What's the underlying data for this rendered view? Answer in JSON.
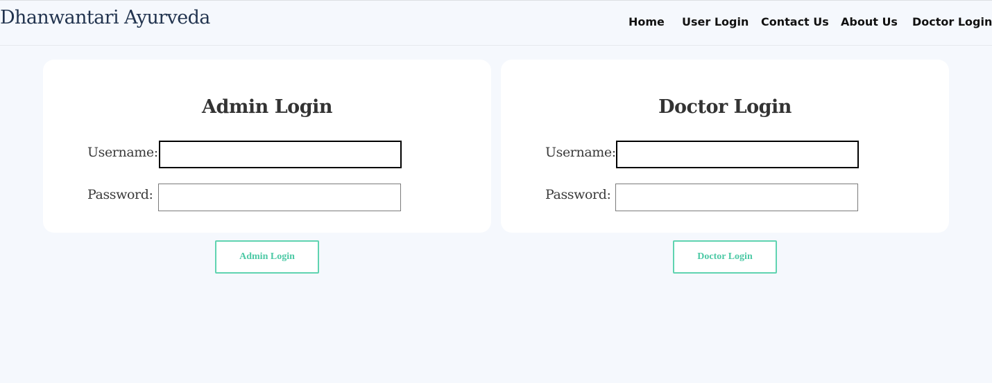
{
  "header": {
    "brand": "Dhanwantari Ayurveda",
    "nav": [
      "Home",
      "User Login",
      "Contact Us",
      "About Us",
      "Doctor Login"
    ]
  },
  "admin": {
    "title": "Admin Login",
    "username_label": "Username:",
    "password_label": "Password:",
    "username_value": "",
    "password_value": "",
    "button": "Admin Login"
  },
  "doctor": {
    "title": "Doctor Login",
    "username_label": "Username:",
    "password_label": "Password:",
    "username_value": "",
    "password_value": "",
    "button": "Doctor Login"
  },
  "colors": {
    "background": "#f5f8fd",
    "brand": "#22344f",
    "accent": "#4cc9a5"
  }
}
